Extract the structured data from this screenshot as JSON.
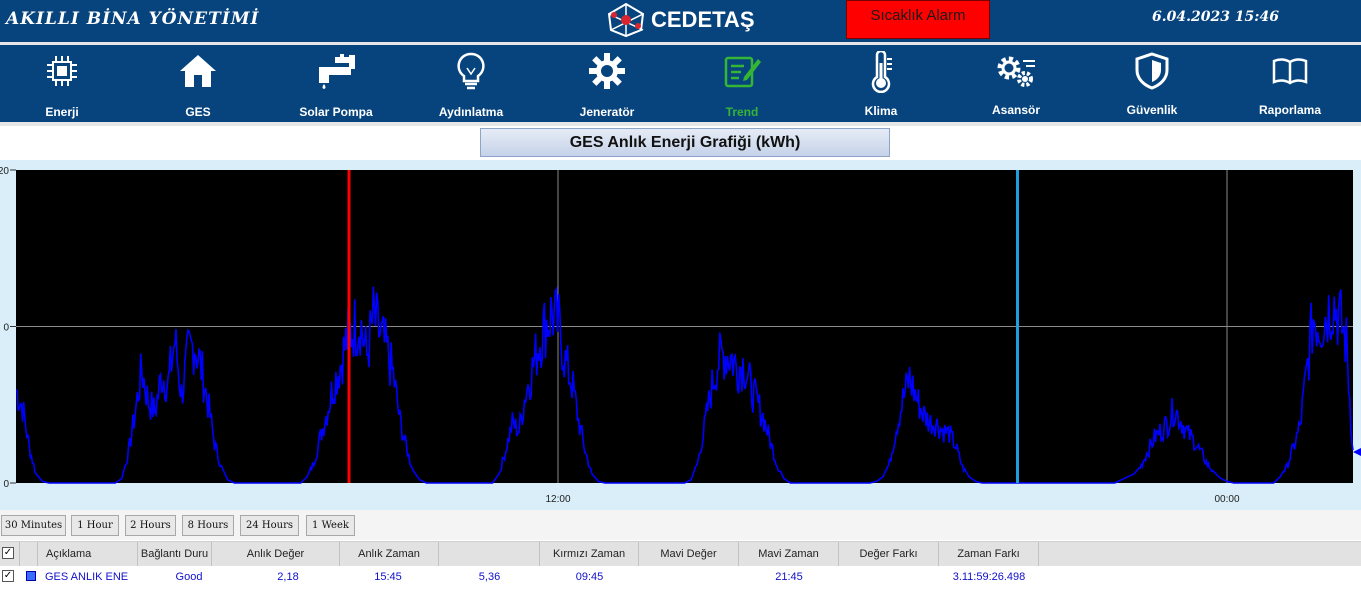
{
  "header": {
    "app_title": "AKILLI BİNA YÖNETİMİ",
    "logo_text": "CEDETAŞ",
    "alarm_label": "Sıcaklık Alarm",
    "datetime": "6.04.2023 15:46",
    "alarm_color": "#ff0000",
    "bar_color": "#07447e"
  },
  "nav": {
    "items": [
      {
        "label": "Enerji",
        "icon": "chip-icon"
      },
      {
        "label": "GES",
        "icon": "home-icon"
      },
      {
        "label": "Solar Pompa",
        "icon": "faucet-icon"
      },
      {
        "label": "Aydınlatma",
        "icon": "lightbulb-icon"
      },
      {
        "label": "Jeneratör",
        "icon": "gear-icon"
      },
      {
        "label": "Trend",
        "icon": "edit-icon",
        "active": true
      },
      {
        "label": "Klima",
        "icon": "thermometer-icon"
      },
      {
        "label": "Asansör",
        "icon": "gears-icon"
      },
      {
        "label": "Güvenlik",
        "icon": "shield-icon"
      },
      {
        "label": "Raporlama",
        "icon": "book-icon"
      }
    ],
    "active_color": "#35b535"
  },
  "chart_title": "GES Anlık Enerji Grafiği (kWh)",
  "chart_data": {
    "type": "line",
    "title": "GES Anlık Enerji Grafiği (kWh)",
    "xlabel": "",
    "ylabel": "",
    "x_tick_labels": [
      "12:00",
      "00:00"
    ],
    "y_tick_labels": [
      "0",
      "0",
      "20"
    ],
    "ylim": [
      0,
      20
    ],
    "grid": true,
    "background": "#000000",
    "series": [
      {
        "color": "#0000ff",
        "values": [
          6.4,
          5.2,
          2.5,
          0.6,
          0.1,
          0,
          0,
          0,
          0,
          0,
          0,
          0,
          0,
          0,
          0,
          0,
          0.3,
          2.1,
          4.8,
          7.8,
          5.6,
          4.9,
          7.4,
          6.8,
          9.8,
          6.1,
          8.8,
          9.6,
          7.9,
          5.5,
          2.7,
          1.1,
          0.2,
          0,
          0,
          0,
          0,
          0,
          0,
          0,
          0,
          0,
          0,
          0,
          0.4,
          1.4,
          3.2,
          4.9,
          6.8,
          8.1,
          9.9,
          10.7,
          11.1,
          8.7,
          11.4,
          10.2,
          9.1,
          7.4,
          4.3,
          2.4,
          0.8,
          0.2,
          0,
          0,
          0,
          0,
          0,
          0,
          0,
          0,
          0,
          0,
          0,
          0.6,
          2.3,
          4.1,
          3.6,
          6.2,
          7.8,
          9.6,
          10.9,
          11.7,
          10.8,
          8.3,
          6.9,
          4.3,
          2.2,
          0.6,
          0.1,
          0,
          0,
          0,
          0,
          0,
          0,
          0,
          0,
          0,
          0,
          0,
          0,
          0,
          0.2,
          1.4,
          3.8,
          6.3,
          8.3,
          8.9,
          8.7,
          7.9,
          8.2,
          6.6,
          5.5,
          4.4,
          2.8,
          1.2,
          0.3,
          0,
          0,
          0,
          0,
          0,
          0,
          0,
          0,
          0,
          0,
          0,
          0,
          0,
          0.1,
          0.4,
          1.4,
          3.8,
          5.7,
          7.2,
          5.9,
          4.8,
          4.2,
          4.1,
          3.6,
          3.4,
          2.5,
          1.1,
          0.4,
          0.1,
          0,
          0,
          0,
          0,
          0,
          0,
          0,
          0,
          0,
          0,
          0,
          0,
          0,
          0,
          0,
          0,
          0,
          0,
          0,
          0,
          0,
          0.2,
          0.4,
          0.6,
          1.2,
          2.2,
          3.1,
          3.6,
          4.1,
          5.1,
          4.3,
          3.4,
          2.9,
          2.1,
          1.3,
          0.7,
          0.3,
          0.1,
          0,
          0,
          0,
          0,
          0,
          0,
          0,
          0.4,
          1.1,
          2.4,
          3.9,
          7.6,
          11.4,
          10.9,
          11.6,
          12.5,
          11.3,
          9.6,
          2.1
        ]
      }
    ],
    "cursors": [
      {
        "name": "Kırmızı Zaman",
        "color": "#ff0000",
        "time": "09:45"
      },
      {
        "name": "Mavi Zaman",
        "color": "#1e9fdc",
        "time": "21:45"
      }
    ]
  },
  "range_buttons": [
    "30 Minutes",
    "1 Hour",
    "2 Hours",
    "8 Hours",
    "24 Hours",
    "1 Week"
  ],
  "table": {
    "headers": [
      "Açıklama",
      "Bağlantı Duru",
      "Anlık Değer",
      "Anlık Zaman",
      "",
      "Kırmızı Zaman",
      "Mavi Değer",
      "Mavi Zaman",
      "Değer Farkı",
      "Zaman Farkı"
    ],
    "rows": [
      {
        "description": "GES ANLIK ENE",
        "status": "Good",
        "value": "2,18",
        "time": "15:45",
        "red_value": "5,36",
        "red_time": "09:45",
        "blue_value": "",
        "blue_time": "21:45",
        "value_diff": "",
        "time_diff": "3.11:59:26.498"
      }
    ]
  }
}
